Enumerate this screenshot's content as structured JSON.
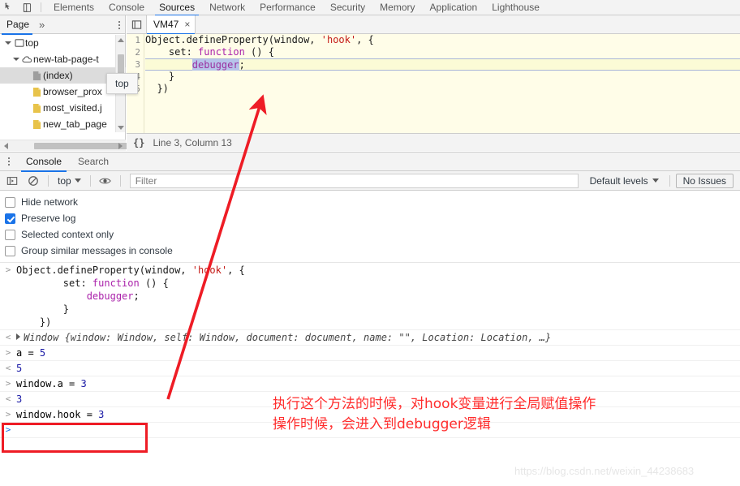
{
  "devtools": {
    "icons": {
      "inspect": "inspect-element-icon",
      "device": "device-toolbar-icon"
    },
    "tabs": [
      {
        "label": "Elements",
        "active": false
      },
      {
        "label": "Console",
        "active": false
      },
      {
        "label": "Sources",
        "active": true
      },
      {
        "label": "Network",
        "active": false
      },
      {
        "label": "Performance",
        "active": false
      },
      {
        "label": "Security",
        "active": false
      },
      {
        "label": "Memory",
        "active": false
      },
      {
        "label": "Application",
        "active": false
      },
      {
        "label": "Lighthouse",
        "active": false
      }
    ]
  },
  "navigator": {
    "tab_label": "Page",
    "more_label": "»",
    "tooltip": "top",
    "tree": [
      {
        "label": "top",
        "indent": 0,
        "caret": "open",
        "icon": "frame-icon",
        "selected": false
      },
      {
        "label": "new-tab-page-t",
        "indent": 1,
        "caret": "open",
        "icon": "cloud-icon",
        "selected": false
      },
      {
        "label": "(index)",
        "indent": 2,
        "caret": "none",
        "icon": "document-icon",
        "selected": true
      },
      {
        "label": "browser_prox",
        "indent": 2,
        "caret": "none",
        "icon": "folder-icon",
        "selected": false
      },
      {
        "label": "most_visited.j",
        "indent": 2,
        "caret": "none",
        "icon": "folder-icon",
        "selected": false
      },
      {
        "label": "new_tab_page",
        "indent": 2,
        "caret": "none",
        "icon": "folder-icon",
        "selected": false
      }
    ]
  },
  "editor": {
    "tab_label": "VM47",
    "close_label": "×",
    "line_numbers": [
      "1",
      "2",
      "3",
      "4",
      "5"
    ],
    "code_lines": [
      "Object.defineProperty(window, 'hook', {",
      "    set: function () {",
      "        debugger;",
      "    }",
      "  })"
    ],
    "status": {
      "format_icon": "{}",
      "position": "Line 3, Column 13"
    }
  },
  "drawer": {
    "tabs": [
      {
        "label": "Console",
        "active": true
      },
      {
        "label": "Search",
        "active": false
      }
    ],
    "toolbar": {
      "sidebar_icon": "console-sidebar-icon",
      "clear_icon": "clear-console-icon",
      "context": "top",
      "eye_icon": "live-expression-icon",
      "filter_placeholder": "Filter",
      "levels": "Default levels",
      "issues": "No Issues"
    },
    "settings": [
      {
        "label": "Hide network",
        "checked": false
      },
      {
        "label": "Preserve log",
        "checked": true
      },
      {
        "label": "Selected context only",
        "checked": false
      },
      {
        "label": "Group similar messages in console",
        "checked": false
      }
    ],
    "messages": [
      {
        "kind": "input",
        "lines": [
          "Object.defineProperty(window, 'hook', {",
          "        set: function () {",
          "            debugger;",
          "        }",
          "    })"
        ]
      },
      {
        "kind": "output",
        "text": "Window {window: Window, self: Window, document: document, name: \"\", Location: Location, …}"
      },
      {
        "kind": "input",
        "text": "a = 5"
      },
      {
        "kind": "output",
        "text": "5"
      },
      {
        "kind": "input",
        "text": "window.a = 3"
      },
      {
        "kind": "output",
        "text": "3"
      },
      {
        "kind": "input",
        "text": "window.hook = 3",
        "highlighted": true
      },
      {
        "kind": "prompt",
        "text": ""
      }
    ]
  },
  "annotations": {
    "note_line1": "执行这个方法的时候，对hook变量进行全局赋值操作",
    "note_line2": "操作时候，会进入到debugger逻辑",
    "accent_color": "#ff2d2d",
    "box_color": "#ee1c25"
  },
  "watermark": "https://blog.csdn.net/weixin_44238683"
}
